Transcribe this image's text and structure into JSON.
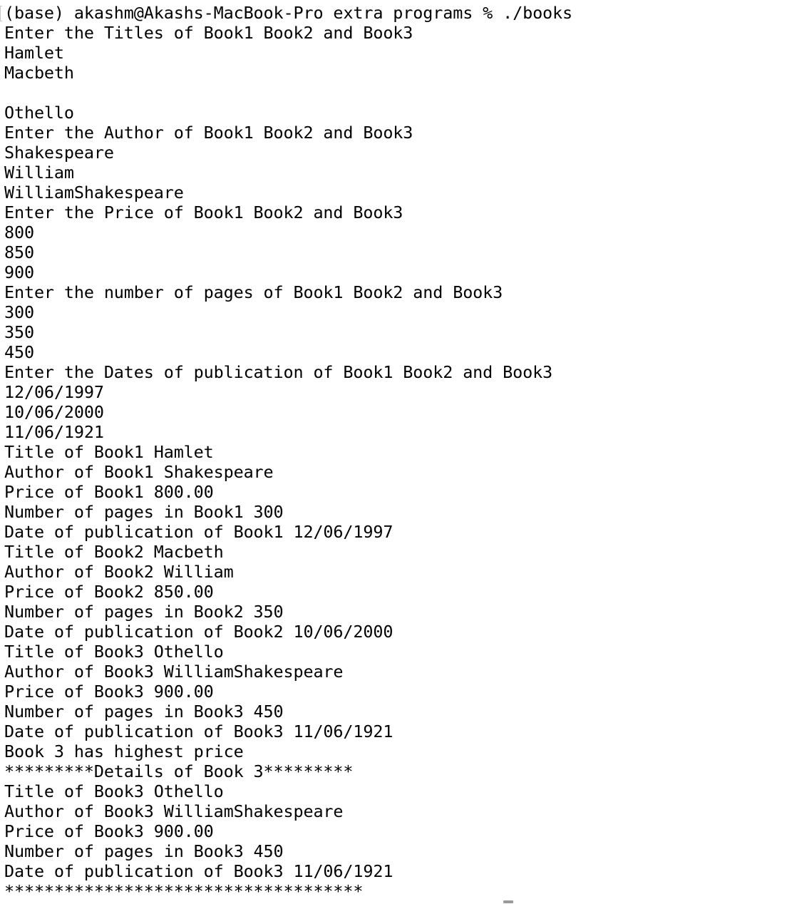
{
  "terminal": {
    "lines": [
      "(base) akashm@Akashs-MacBook-Pro extra programs % ./books",
      "Enter the Titles of Book1 Book2 and Book3",
      "Hamlet",
      "Macbeth",
      "",
      "Othello",
      "Enter the Author of Book1 Book2 and Book3",
      "Shakespeare",
      "William",
      "WilliamShakespeare",
      "Enter the Price of Book1 Book2 and Book3",
      "800",
      "850",
      "900",
      "Enter the number of pages of Book1 Book2 and Book3",
      "300",
      "350",
      "450",
      "Enter the Dates of publication of Book1 Book2 and Book3",
      "12/06/1997",
      "10/06/2000",
      "11/06/1921",
      "Title of Book1 Hamlet",
      "Author of Book1 Shakespeare",
      "Price of Book1 800.00",
      "Number of pages in Book1 300",
      "Date of publication of Book1 12/06/1997",
      "Title of Book2 Macbeth",
      "Author of Book2 William",
      "Price of Book2 850.00",
      "Number of pages in Book2 350",
      "Date of publication of Book2 10/06/2000",
      "Title of Book3 Othello",
      "Author of Book3 WilliamShakespeare",
      "Price of Book3 900.00",
      "Number of pages in Book3 450",
      "Date of publication of Book3 11/06/1921",
      "Book 3 has highest price",
      "*********Details of Book 3*********",
      "Title of Book3 Othello",
      "Author of Book3 WilliamShakespeare",
      "Price of Book3 900.00",
      "Number of pages in Book3 450",
      "Date of publication of Book3 11/06/1921",
      "************************************"
    ]
  }
}
